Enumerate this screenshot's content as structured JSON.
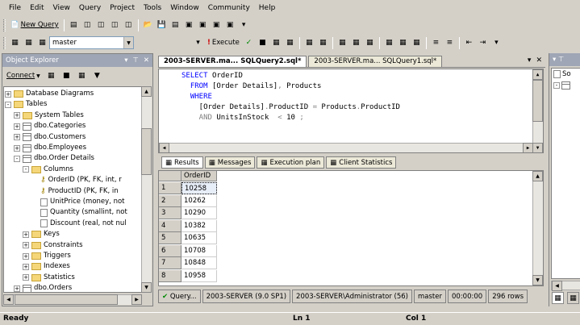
{
  "menu": [
    "File",
    "Edit",
    "View",
    "Query",
    "Project",
    "Tools",
    "Window",
    "Community",
    "Help"
  ],
  "toolbar1": {
    "new_query": "New Query"
  },
  "toolbar2": {
    "database": "master",
    "execute": "Execute"
  },
  "object_explorer": {
    "title": "Object Explorer",
    "connect": "Connect",
    "tree": [
      {
        "label": "Database Diagrams",
        "indent": 0,
        "kind": "folder",
        "pm": "+"
      },
      {
        "label": "Tables",
        "indent": 0,
        "kind": "folder",
        "pm": "-"
      },
      {
        "label": "System Tables",
        "indent": 1,
        "kind": "folder",
        "pm": "+"
      },
      {
        "label": "dbo.Categories",
        "indent": 1,
        "kind": "table",
        "pm": "+"
      },
      {
        "label": "dbo.Customers",
        "indent": 1,
        "kind": "table",
        "pm": "+"
      },
      {
        "label": "dbo.Employees",
        "indent": 1,
        "kind": "table",
        "pm": "+"
      },
      {
        "label": "dbo.Order Details",
        "indent": 1,
        "kind": "table",
        "pm": "-"
      },
      {
        "label": "Columns",
        "indent": 2,
        "kind": "folder",
        "pm": "-"
      },
      {
        "label": "OrderID (PK, FK, int, r",
        "indent": 3,
        "kind": "key",
        "pm": ""
      },
      {
        "label": "ProductID (PK, FK, in",
        "indent": 3,
        "kind": "key",
        "pm": ""
      },
      {
        "label": "UnitPrice (money, not",
        "indent": 3,
        "kind": "col",
        "pm": ""
      },
      {
        "label": "Quantity (smallint, not",
        "indent": 3,
        "kind": "col",
        "pm": ""
      },
      {
        "label": "Discount (real, not nul",
        "indent": 3,
        "kind": "col",
        "pm": ""
      },
      {
        "label": "Keys",
        "indent": 2,
        "kind": "folder",
        "pm": "+"
      },
      {
        "label": "Constraints",
        "indent": 2,
        "kind": "folder",
        "pm": "+"
      },
      {
        "label": "Triggers",
        "indent": 2,
        "kind": "folder",
        "pm": "+"
      },
      {
        "label": "Indexes",
        "indent": 2,
        "kind": "folder",
        "pm": "+"
      },
      {
        "label": "Statistics",
        "indent": 2,
        "kind": "folder",
        "pm": "+"
      },
      {
        "label": "dbo.Orders",
        "indent": 1,
        "kind": "table",
        "pm": "+"
      }
    ]
  },
  "editor": {
    "tabs": [
      "2003-SERVER.ma... SQLQuery2.sql*",
      "2003-SERVER.ma... SQLQuery1.sql*"
    ],
    "code": [
      {
        "parts": [
          {
            "t": "SELECT ",
            "c": "kw"
          },
          {
            "t": "OrderID",
            "c": ""
          }
        ]
      },
      {
        "parts": [
          {
            "t": "  FROM ",
            "c": "kw"
          },
          {
            "t": "[Order Details]",
            "c": ""
          },
          {
            "t": ", ",
            "c": "gr"
          },
          {
            "t": "Products",
            "c": ""
          }
        ]
      },
      {
        "parts": [
          {
            "t": "  WHERE",
            "c": "kw"
          }
        ]
      },
      {
        "parts": [
          {
            "t": "    [Order Details]",
            "c": ""
          },
          {
            "t": ".",
            "c": "gr"
          },
          {
            "t": "ProductID ",
            "c": ""
          },
          {
            "t": "= ",
            "c": "gr"
          },
          {
            "t": "Products",
            "c": ""
          },
          {
            "t": ".",
            "c": "gr"
          },
          {
            "t": "ProductID",
            "c": ""
          }
        ]
      },
      {
        "parts": [
          {
            "t": "    AND ",
            "c": "gr"
          },
          {
            "t": "UnitsInStock ",
            "c": ""
          },
          {
            "t": " < ",
            "c": "gr"
          },
          {
            "t": "10 ",
            "c": ""
          },
          {
            "t": ";",
            "c": "gr"
          }
        ]
      }
    ]
  },
  "result_tabs": [
    "Results",
    "Messages",
    "Execution plan",
    "Client Statistics"
  ],
  "results": {
    "header": "OrderID",
    "rows": [
      {
        "n": "1",
        "v": "10258"
      },
      {
        "n": "2",
        "v": "10262"
      },
      {
        "n": "3",
        "v": "10290"
      },
      {
        "n": "4",
        "v": "10382"
      },
      {
        "n": "5",
        "v": "10635"
      },
      {
        "n": "6",
        "v": "10708"
      },
      {
        "n": "7",
        "v": "10848"
      },
      {
        "n": "8",
        "v": "10958"
      }
    ]
  },
  "query_status": [
    "Query...",
    "2003-SERVER (9.0 SP1)",
    "2003-SERVER\\Administrator (56)",
    "master",
    "00:00:00",
    "296 rows"
  ],
  "right_panel": {
    "title": "So",
    "items": [
      "So"
    ]
  },
  "statusbar": {
    "left": "Ready",
    "ln": "Ln 1",
    "col": "Col 1"
  }
}
